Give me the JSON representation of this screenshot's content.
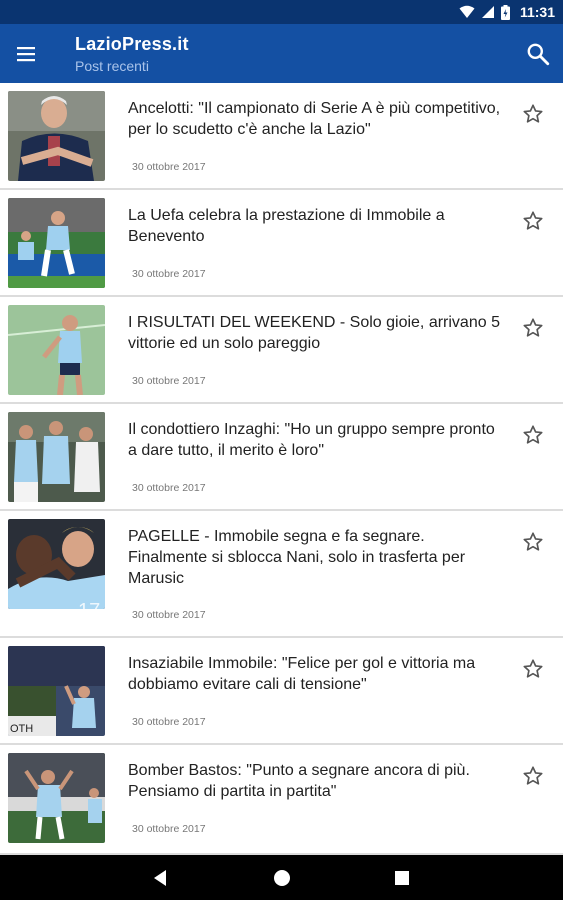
{
  "status_bar": {
    "time": "11:31"
  },
  "app_bar": {
    "title": "LazioPress.it",
    "subtitle": "Post recenti"
  },
  "colors": {
    "status_bar": "#0a3470",
    "app_bar": "#1450a3",
    "subtitle": "#a9c3ea"
  },
  "icons": {
    "menu": "menu-icon",
    "search": "search-icon",
    "favorite": "star-outline-icon",
    "back": "back-triangle-icon",
    "home": "home-circle-icon",
    "recents": "recents-square-icon"
  },
  "posts": [
    {
      "title": "Ancelotti: \"Il campionato di Serie A è più competitivo, per lo scudetto c'è anche la Lazio\"",
      "date": "30 ottobre 2017"
    },
    {
      "title": "La Uefa celebra la prestazione di Immobile a Benevento",
      "date": "30 ottobre 2017"
    },
    {
      "title": "I RISULTATI DEL WEEKEND - Solo gioie, arrivano 5 vittorie ed un solo pareggio",
      "date": "30 ottobre 2017"
    },
    {
      "title": "Il condottiero Inzaghi: \"Ho un gruppo sempre pronto a dare tutto, il merito è loro\"",
      "date": "30 ottobre 2017"
    },
    {
      "title": "PAGELLE - Immobile segna e fa segnare. Finalmente si sblocca Nani, solo in trasferta per Marusic",
      "date": "30 ottobre 2017"
    },
    {
      "title": "Insaziabile Immobile: \"Felice per gol e vittoria ma dobbiamo evitare cali di tensione\"",
      "date": "30 ottobre 2017"
    },
    {
      "title": "Bomber Bastos: \"Punto a segnare ancora di più. Pensiamo di partita in partita\"",
      "date": "30 ottobre 2017"
    }
  ]
}
